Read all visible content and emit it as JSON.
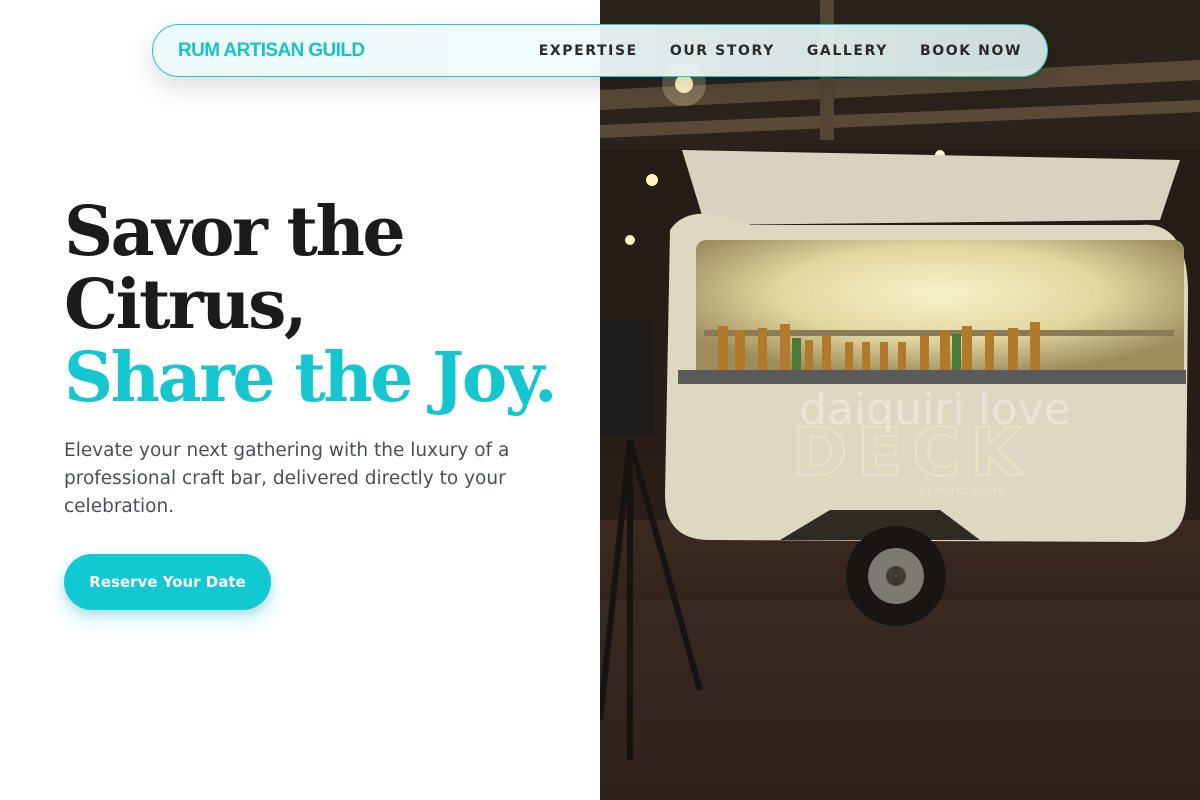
{
  "nav": {
    "brand": "RUM ARTISAN GUILD",
    "links": [
      "EXPERTISE",
      "OUR STORY",
      "GALLERY",
      "BOOK NOW"
    ]
  },
  "hero": {
    "title_line1": "Savor the",
    "title_line2": "Citrus,",
    "title_line3": "Share the Joy.",
    "subtitle": "Elevate your next gathering with the luxury of a professional craft bar, delivered directly to your celebration.",
    "cta_label": "Reserve Your Date"
  },
  "photo": {
    "sign_script": "daiquiri love",
    "sign_main": "DECK",
    "sign_small": "BY SOTTO FORTE"
  },
  "colors": {
    "accent": "#14c6cf",
    "heading": "#1b1b1b",
    "body_text": "#4a4f57"
  }
}
